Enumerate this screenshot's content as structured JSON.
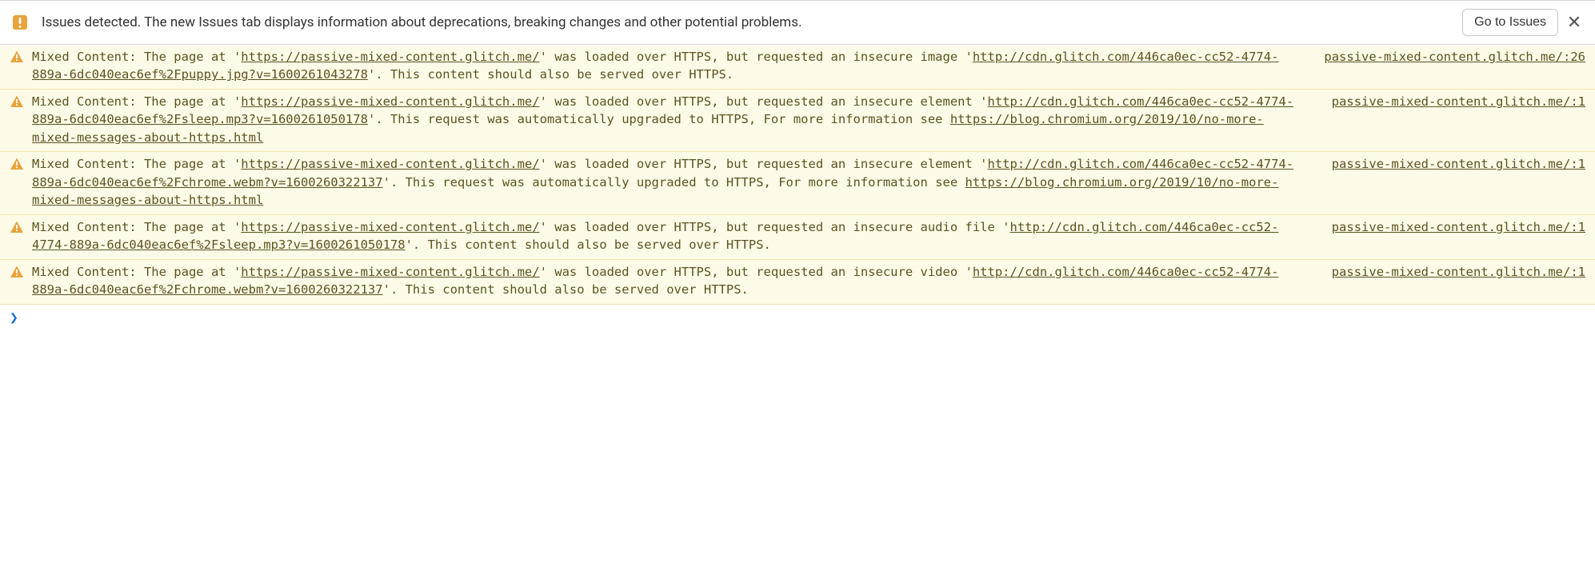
{
  "issues_bar": {
    "text": "Issues detected. The new Issues tab displays information about deprecations, breaking changes and other potential problems.",
    "button_label": "Go to Issues",
    "close_glyph": "✕"
  },
  "page_url": "https://passive-mixed-content.glitch.me/",
  "source_host": "passive-mixed-content.glitch.me/",
  "rows": [
    {
      "pre1": "Mixed Content: The page at '",
      "post1": "' was loaded over HTTPS, but requested an insecure image '",
      "resource": "http://cdn.glitch.com/446ca0ec-cc52-4774-889a-6dc040eac6ef%2Fpuppy.jpg?v=1600261043278",
      "post2": "'. This content should also be served over HTTPS.",
      "more_pre": "",
      "more_link": "",
      "source_line": ":26"
    },
    {
      "pre1": "Mixed Content: The page at '",
      "post1": "' was loaded over HTTPS, but requested an insecure element '",
      "resource": "http://cdn.glitch.com/446ca0ec-cc52-4774-889a-6dc040eac6ef%2Fsleep.mp3?v=1600261050178",
      "post2": "'. This request was automatically upgraded to HTTPS, For more information see ",
      "more_pre": "",
      "more_link": "https://blog.chromium.org/2019/10/no-more-mixed-messages-about-https.html",
      "source_line": ":1"
    },
    {
      "pre1": "Mixed Content: The page at '",
      "post1": "' was loaded over HTTPS, but requested an insecure element '",
      "resource": "http://cdn.glitch.com/446ca0ec-cc52-4774-889a-6dc040eac6ef%2Fchrome.webm?v=1600260322137",
      "post2": "'. This request was automatically upgraded to HTTPS, For more information see ",
      "more_pre": "",
      "more_link": "https://blog.chromium.org/2019/10/no-more-mixed-messages-about-https.html",
      "source_line": ":1"
    },
    {
      "pre1": "Mixed Content: The page at '",
      "post1": "' was loaded over HTTPS, but requested an insecure audio file '",
      "resource": "http://cdn.glitch.com/446ca0ec-cc52-4774-889a-6dc040eac6ef%2Fsleep.mp3?v=1600261050178",
      "post2": "'. This content should also be served over HTTPS.",
      "more_pre": "",
      "more_link": "",
      "source_line": ":1"
    },
    {
      "pre1": "Mixed Content: The page at '",
      "post1": "' was loaded over HTTPS, but requested an insecure video '",
      "resource": "http://cdn.glitch.com/446ca0ec-cc52-4774-889a-6dc040eac6ef%2Fchrome.webm?v=1600260322137",
      "post2": "'. This content should also be served over HTTPS.",
      "more_pre": "",
      "more_link": "",
      "source_line": ":1"
    }
  ],
  "prompt": {
    "caret": "❯"
  }
}
